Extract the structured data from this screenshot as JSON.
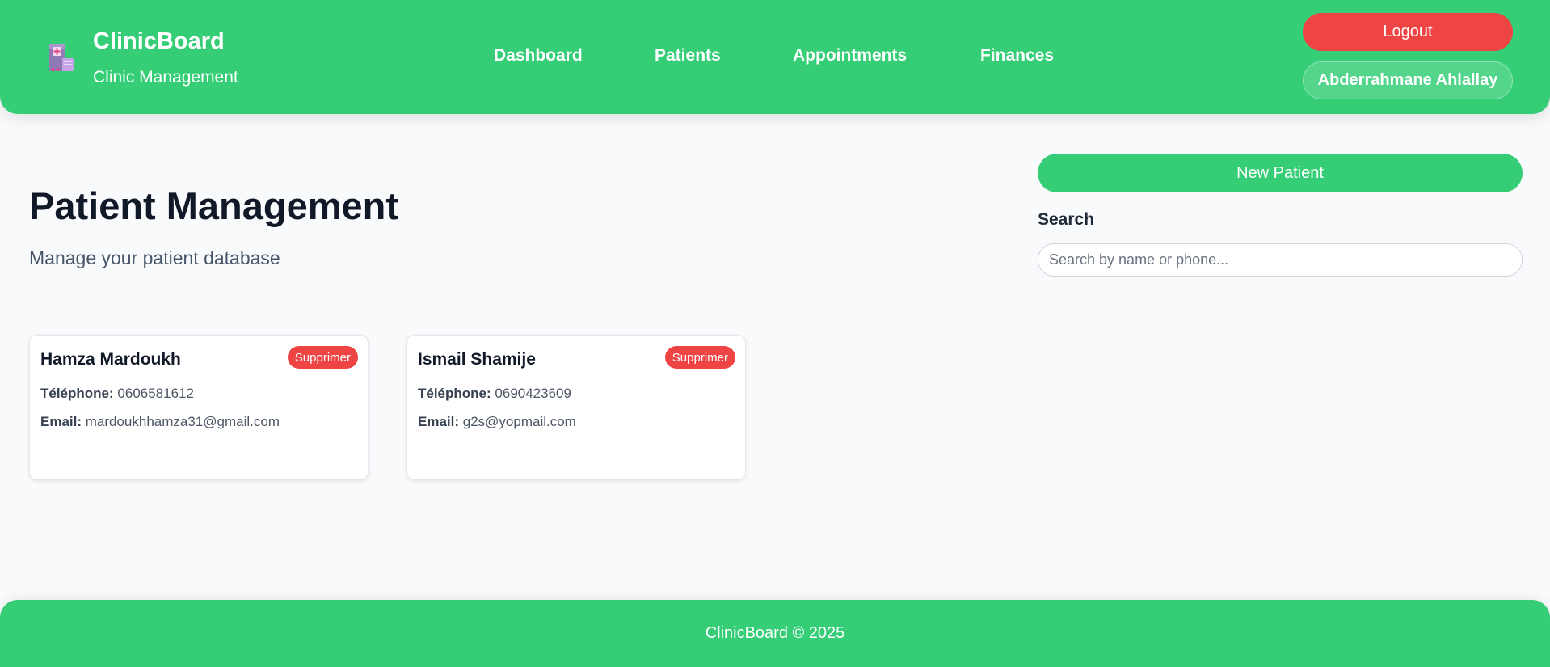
{
  "colors": {
    "primary": "#35ce77",
    "danger": "#ef4444",
    "background": "#f8fafc"
  },
  "header": {
    "logo_icon": "clinic-building-icon",
    "brand_title": "ClinicBoard",
    "brand_subtitle": "Clinic Management",
    "nav": [
      {
        "label": "Dashboard"
      },
      {
        "label": "Patients"
      },
      {
        "label": "Appointments"
      },
      {
        "label": "Finances"
      }
    ],
    "logout_label": "Logout",
    "user_name": "Abderrahmane Ahlallay"
  },
  "main": {
    "title": "Patient Management",
    "subtitle": "Manage your patient database",
    "new_patient_label": "New Patient",
    "search": {
      "label": "Search",
      "placeholder": "Search by name or phone...",
      "value": ""
    },
    "patients": [
      {
        "name": "Hamza Mardoukh",
        "phone_label": "Téléphone:",
        "phone": "0606581612",
        "email_label": "Email:",
        "email": "mardoukhhamza31@gmail.com",
        "delete_label": "Supprimer"
      },
      {
        "name": "Ismail Shamije",
        "phone_label": "Téléphone:",
        "phone": "0690423609",
        "email_label": "Email:",
        "email": "g2s@yopmail.com",
        "delete_label": "Supprimer"
      }
    ]
  },
  "footer": {
    "text": "ClinicBoard © 2025"
  }
}
